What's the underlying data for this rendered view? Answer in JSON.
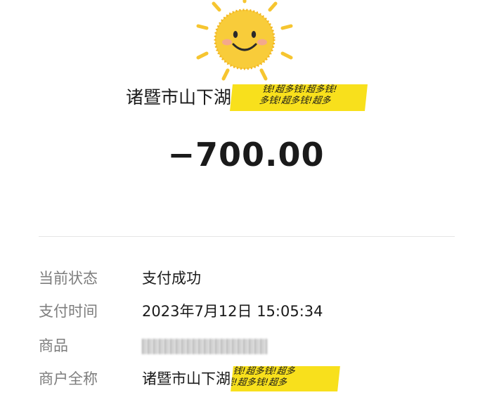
{
  "header": {
    "merchant_name": "诸暨市山下湖",
    "sticker_text_top": "钱!超多钱!超多钱!",
    "sticker_text_bottom": "多钱!超多钱!超多"
  },
  "amount": "−700.00",
  "details": [
    {
      "label": "当前状态",
      "value": "支付成功"
    },
    {
      "label": "支付时间",
      "value": "2023年7月12日 15:05:34"
    },
    {
      "label": "商品",
      "value": ""
    },
    {
      "label": "商户全称",
      "value": "诸暨市山下湖"
    }
  ],
  "merchant_sticker": {
    "text_top": "钱!超多钱!超多",
    "text_bottom": "钱!超多钱!超多"
  },
  "colors": {
    "sun": "#f6c530",
    "sticker": "#f8e01c",
    "label": "#7d7d7d",
    "value": "#1a1a1a"
  },
  "icons": {
    "sun": "smiling-sun-icon"
  }
}
